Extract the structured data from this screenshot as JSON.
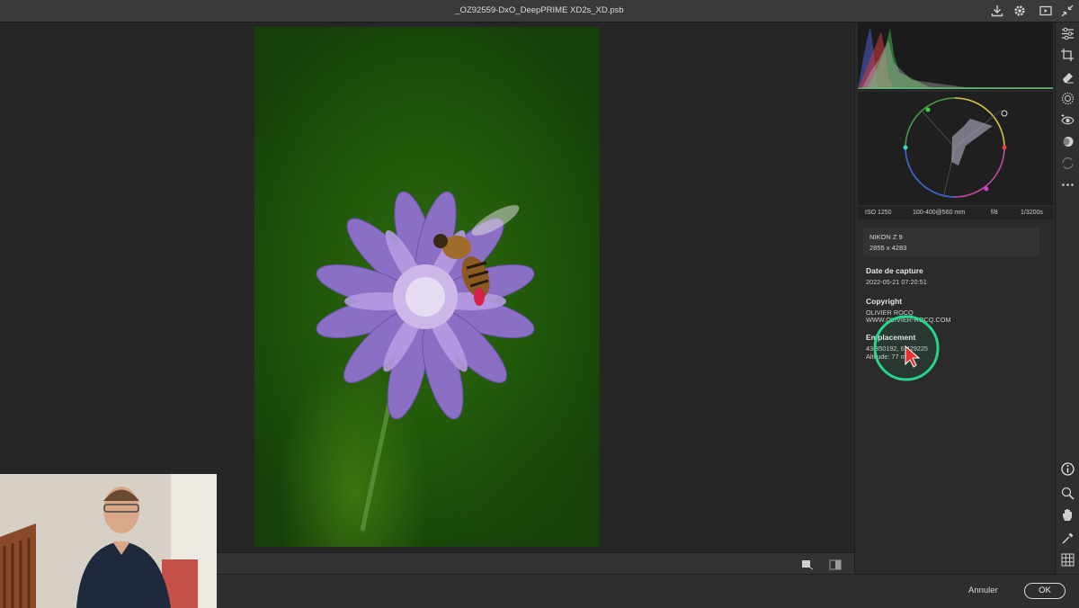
{
  "window": {
    "title": "_OZ92559-DxO_DeepPRIME XD2s_XD.psb"
  },
  "exif": {
    "iso": "ISO 1250",
    "lens": "100-400@560 mm",
    "aperture": "f/8",
    "shutter": "1/3200s"
  },
  "camera": {
    "model": "NIKON Z 9",
    "dimensions": "2855 x 4283"
  },
  "metadata": {
    "capture_label": "Date de capture",
    "capture_value": "2022-05-21 07:20:51",
    "copyright_label": "Copyright",
    "copyright_name": "OLIVIER ROCQ",
    "copyright_site": "WWW.OLIVIER-ROCQ.COM",
    "location_label": "Emplacement",
    "location_coords": "43.350192, 6.429225",
    "location_altitude": "Altitude: 77 m"
  },
  "footer": {
    "cancel_label": "Annuler",
    "ok_label": "OK"
  },
  "icons": {
    "titlebar": [
      "download-icon",
      "gear-icon",
      "play-icon",
      "collapse-icon"
    ],
    "toolbar": [
      "sliders-icon",
      "crop-icon",
      "eraser-icon",
      "radial-mask-icon",
      "red-eye-icon",
      "color-presets-icon",
      "snapshot-icon",
      "more-icon",
      "info-icon",
      "zoom-icon",
      "hand-icon",
      "eyedropper-icon",
      "grid-icon"
    ]
  },
  "colors": {
    "highlight_ring": "#25d68b",
    "cursor": "#e83030",
    "accent_green": "#2f6b0e"
  }
}
